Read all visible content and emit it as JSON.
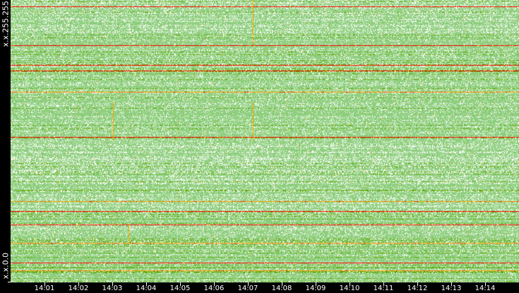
{
  "chart_data": {
    "type": "heatmap",
    "title": "",
    "y_axis": {
      "top_label": "x.x.255.255",
      "bottom_label": "x.x.0.0",
      "range": [
        0,
        255
      ]
    },
    "x_axis": {
      "ticks": [
        "14:01",
        "14:02",
        "14:03",
        "14:04",
        "14:05",
        "14:06",
        "14:07",
        "14:08",
        "14:09",
        "14:10",
        "14:11",
        "14:12",
        "14:13",
        "14:14"
      ],
      "range_minutes": [
        "14:00:00",
        "14:15:00"
      ]
    },
    "colors": {
      "low": "#8fcf7f",
      "mid": "#5aa800",
      "high": "#ffa500",
      "max": "#ff0000",
      "empty": "#ffffff"
    },
    "notable_rows": [
      {
        "addr_row": 249,
        "level": "max"
      },
      {
        "addr_row": 214,
        "level": "max"
      },
      {
        "addr_row": 196,
        "level": "max"
      },
      {
        "addr_row": 191,
        "level": "max"
      },
      {
        "addr_row": 172,
        "level": "high"
      },
      {
        "addr_row": 131,
        "level": "max"
      },
      {
        "addr_row": 73,
        "level": "high"
      },
      {
        "addr_row": 64,
        "level": "max"
      },
      {
        "addr_row": 52,
        "level": "max"
      },
      {
        "addr_row": 35,
        "level": "high"
      },
      {
        "addr_row": 17,
        "level": "max"
      },
      {
        "addr_row": 10,
        "level": "high"
      }
    ],
    "notable_columns": [
      {
        "time": "14:07:09",
        "addr_from": 214,
        "addr_to": 255
      },
      {
        "time": "14:07:09",
        "addr_from": 128,
        "addr_to": 163
      },
      {
        "time": "14:03:01",
        "addr_from": 128,
        "addr_to": 163
      },
      {
        "time": "14:03:29",
        "addr_from": 36,
        "addr_to": 52
      }
    ]
  }
}
